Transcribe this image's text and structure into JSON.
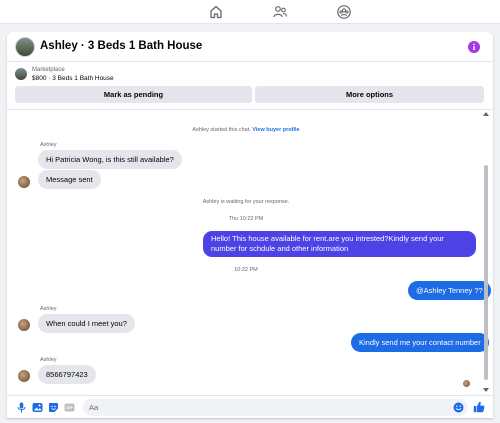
{
  "colors": {
    "accent": "#1e6be6",
    "outgoing_special": "#4d42e6",
    "info": "#a239e4"
  },
  "topnav": {
    "icons": [
      "home-icon",
      "people-icon",
      "groups-icon"
    ]
  },
  "header": {
    "title": "Ashley · 3 Beds 1 Bath House"
  },
  "marketplace": {
    "label": "Marketplace",
    "item": "$800 · 3 Beds 1 Bath House",
    "mark_pending": "Mark as pending",
    "more_options": "More options"
  },
  "thread": {
    "started_prefix": "Ashley started this chat.",
    "view_profile": "View buyer profile",
    "m1_sender": "Ashley",
    "m1_text": "Hi Patricia Wong, is this still available?",
    "m2_text": "Message sent",
    "waiting": "Ashley is waiting for your response.",
    "time1": "Thu 10:22 PM",
    "out1": "Hello! This house available for rent.are you intrested?Kindly send your number for schdule and other information",
    "time2": "10:22 PM",
    "out2": "@Ashley Tenney ??",
    "m3_sender": "Ashley",
    "m3_text": "When could I meet you?",
    "out3": "Kindly send me your contact number",
    "m4_sender": "Ashley",
    "m4_text": "8566797423"
  },
  "composer": {
    "placeholder": "Aa"
  }
}
